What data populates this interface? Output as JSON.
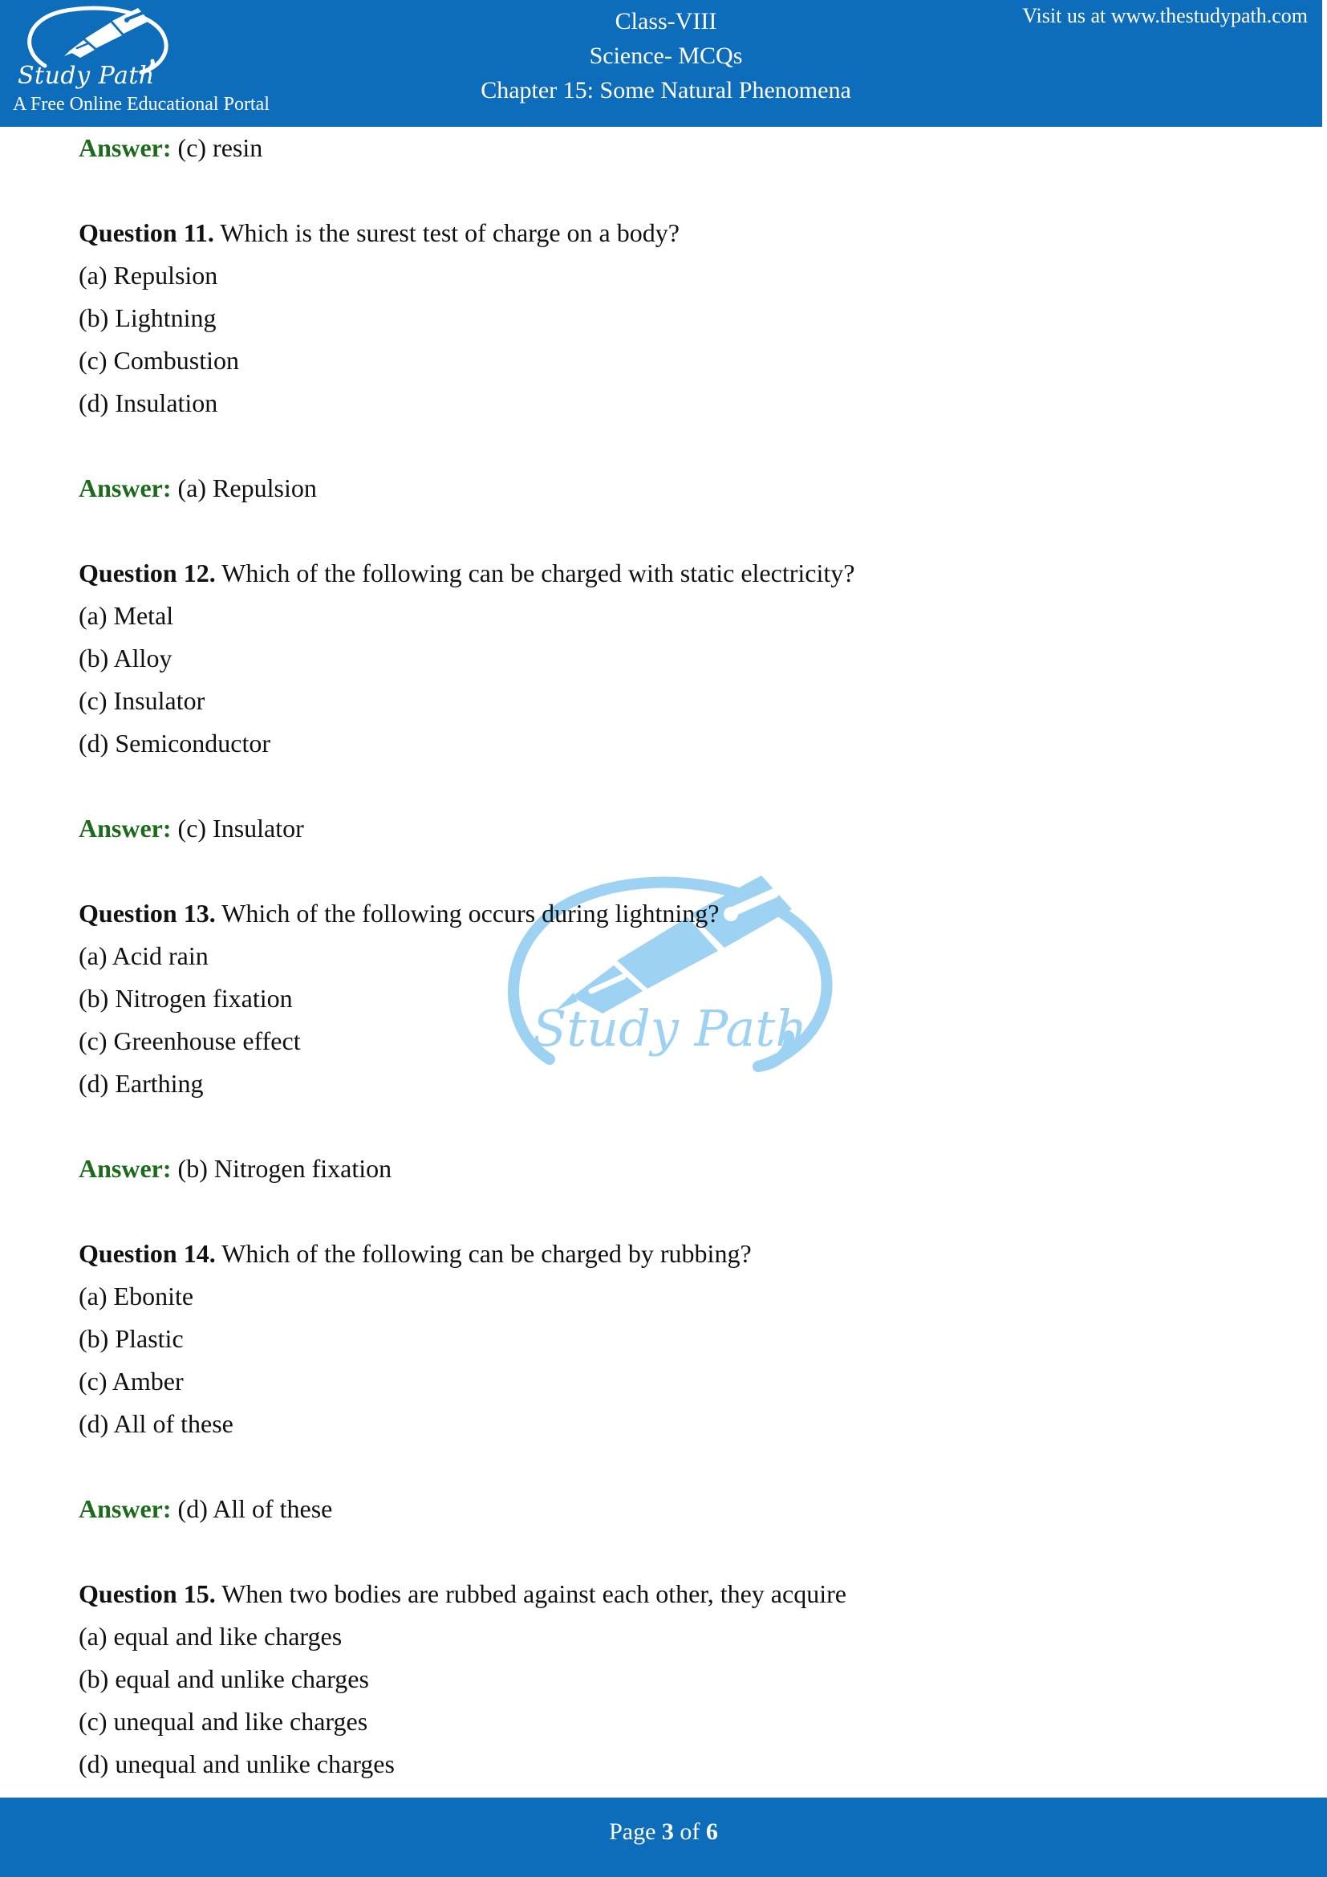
{
  "theme": {
    "brand_blue": "#0e6dba",
    "answer_green": "#1a6b1a",
    "watermark_blue": "#9ed2f2",
    "text_black": "#111111",
    "page_white": "#ffffff"
  },
  "header": {
    "logo": {
      "icon": "fountain-pen-in-oval-loop",
      "script_text": "Study Path",
      "tagline": "A Free Online Educational Portal"
    },
    "titles": [
      "Class-VIII",
      "Science- MCQs",
      "Chapter 15: Some Natural Phenomena"
    ],
    "visit": "Visit us at www.thestudypath.com"
  },
  "watermark": {
    "icon": "fountain-pen-in-oval-loop",
    "script_text": "Study Path"
  },
  "content": {
    "top_answer": {
      "label": "Answer:",
      "value": " (c) resin"
    },
    "questions": [
      {
        "number_label": "Question 11.",
        "prompt": " Which is the surest test of charge on a body?",
        "options": [
          "(a) Repulsion",
          "(b) Lightning",
          "(c) Combustion",
          "(d) Insulation"
        ],
        "answer_label": "Answer:",
        "answer_value": " (a) Repulsion"
      },
      {
        "number_label": "Question 12.",
        "prompt": " Which of the following can be charged with static electricity?",
        "options": [
          "(a) Metal",
          "(b) Alloy",
          "(c) Insulator",
          "(d) Semiconductor"
        ],
        "answer_label": "Answer:",
        "answer_value": " (c) Insulator"
      },
      {
        "number_label": "Question 13.",
        "prompt": " Which of the following occurs during lightning?",
        "options": [
          "(a) Acid rain",
          "(b) Nitrogen fixation",
          "(c) Greenhouse effect",
          "(d) Earthing"
        ],
        "answer_label": "Answer:",
        "answer_value": " (b) Nitrogen fixation"
      },
      {
        "number_label": "Question 14.",
        "prompt": " Which of the following can be charged by rubbing?",
        "options": [
          "(a) Ebonite",
          "(b) Plastic",
          "(c) Amber",
          "(d) All of these"
        ],
        "answer_label": "Answer:",
        "answer_value": " (d) All of these"
      },
      {
        "number_label": "Question 15.",
        "prompt": " When two bodies are rubbed against each other, they acquire",
        "options": [
          "(a) equal and like charges",
          "(b) equal and unlike charges",
          "(c) unequal and like charges",
          "(d) unequal and unlike charges"
        ],
        "answer_label": null,
        "answer_value": null
      }
    ]
  },
  "footer": {
    "page_word": "Page ",
    "current_page": "3",
    "of_word": " of ",
    "total_pages": "6"
  }
}
